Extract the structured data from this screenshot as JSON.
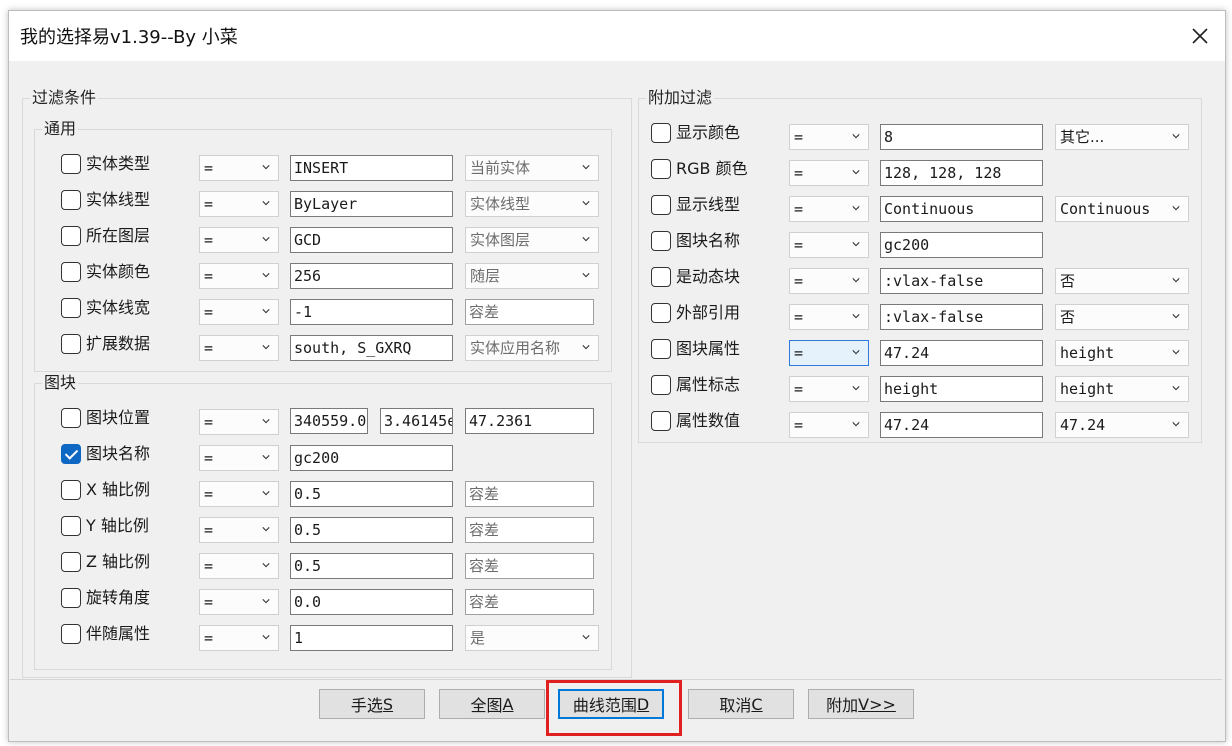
{
  "window": {
    "title": "我的选择易v1.39--By 小菜"
  },
  "filter_group": {
    "label": "过滤条件",
    "general": {
      "label": "通用",
      "rows": [
        {
          "checked": false,
          "label": "实体类型",
          "op": "=",
          "value": "INSERT",
          "option": "当前实体",
          "option_kind": "combo"
        },
        {
          "checked": false,
          "label": "实体线型",
          "op": "=",
          "value": "ByLayer",
          "option": "实体线型",
          "option_kind": "combo"
        },
        {
          "checked": false,
          "label": "所在图层",
          "op": "=",
          "value": "GCD",
          "option": "实体图层",
          "option_kind": "combo"
        },
        {
          "checked": false,
          "label": "实体颜色",
          "op": "=",
          "value": "256",
          "option": "随层",
          "option_kind": "combo"
        },
        {
          "checked": false,
          "label": "实体线宽",
          "op": "=",
          "value": "-1",
          "option": "容差",
          "option_kind": "edit"
        },
        {
          "checked": false,
          "label": "扩展数据",
          "op": "=",
          "value": "south, S_GXRQ",
          "option": "实体应用名称",
          "option_kind": "combo"
        }
      ]
    },
    "block": {
      "label": "图块",
      "position": {
        "checked": false,
        "label": "图块位置",
        "op": "=",
        "x": "340559.0",
        "y": "3.46145e",
        "z": "47.2361"
      },
      "rows": [
        {
          "checked": true,
          "label": "图块名称",
          "op": "=",
          "value": "gc200",
          "option": "",
          "option_kind": "none"
        },
        {
          "checked": false,
          "label": "X 轴比例",
          "op": "=",
          "value": "0.5",
          "option": "容差",
          "option_kind": "edit"
        },
        {
          "checked": false,
          "label": "Y 轴比例",
          "op": "=",
          "value": "0.5",
          "option": "容差",
          "option_kind": "edit"
        },
        {
          "checked": false,
          "label": "Z 轴比例",
          "op": "=",
          "value": "0.5",
          "option": "容差",
          "option_kind": "edit"
        },
        {
          "checked": false,
          "label": "旋转角度",
          "op": "=",
          "value": "0.0",
          "option": "容差",
          "option_kind": "edit"
        },
        {
          "checked": false,
          "label": "伴随属性",
          "op": "=",
          "value": "1",
          "option": "是",
          "option_kind": "combo"
        }
      ]
    }
  },
  "extra_group": {
    "label": "附加过滤",
    "rows": [
      {
        "checked": false,
        "label": "显示颜色",
        "op": "=",
        "value": "8",
        "option": "其它...",
        "option_kind": "combo"
      },
      {
        "checked": false,
        "label": "RGB 颜色",
        "op": "=",
        "value": "128, 128, 128",
        "option": "",
        "option_kind": "none"
      },
      {
        "checked": false,
        "label": "显示线型",
        "op": "=",
        "value": "Continuous",
        "option": "Continuous",
        "option_kind": "combo"
      },
      {
        "checked": false,
        "label": "图块名称",
        "op": "=",
        "value": "gc200",
        "option": "",
        "option_kind": "none"
      },
      {
        "checked": false,
        "label": "是动态块",
        "op": "=",
        "value": ":vlax-false",
        "option": "否",
        "option_kind": "combo"
      },
      {
        "checked": false,
        "label": "外部引用",
        "op": "=",
        "value": ":vlax-false",
        "option": "否",
        "option_kind": "combo"
      },
      {
        "checked": false,
        "label": "图块属性",
        "op": "=",
        "value": "47.24",
        "option": "height",
        "option_kind": "combo",
        "op_focused": true
      },
      {
        "checked": false,
        "label": "属性标志",
        "op": "=",
        "value": "height",
        "option": "height",
        "option_kind": "combo"
      },
      {
        "checked": false,
        "label": "属性数值",
        "op": "=",
        "value": "47.24",
        "option": "47.24",
        "option_kind": "combo"
      }
    ]
  },
  "buttons": [
    {
      "text": "手选",
      "key": "S",
      "name": "manual-select-button"
    },
    {
      "text": "全图",
      "key": "A",
      "name": "whole-drawing-button"
    },
    {
      "text": "曲线范围",
      "key": "D",
      "name": "curve-range-button",
      "default": true
    },
    {
      "text": "取消",
      "key": "C",
      "name": "cancel-button"
    },
    {
      "text": "附加",
      "key": "V>>",
      "name": "extra-button"
    }
  ],
  "colors": {
    "accent": "#0f67c4",
    "highlight": "#e02020",
    "window_bg": "#f0f0f0"
  },
  "icons": {
    "close": "close-icon",
    "dropdown": "chevron-down-icon",
    "check": "check-icon"
  }
}
